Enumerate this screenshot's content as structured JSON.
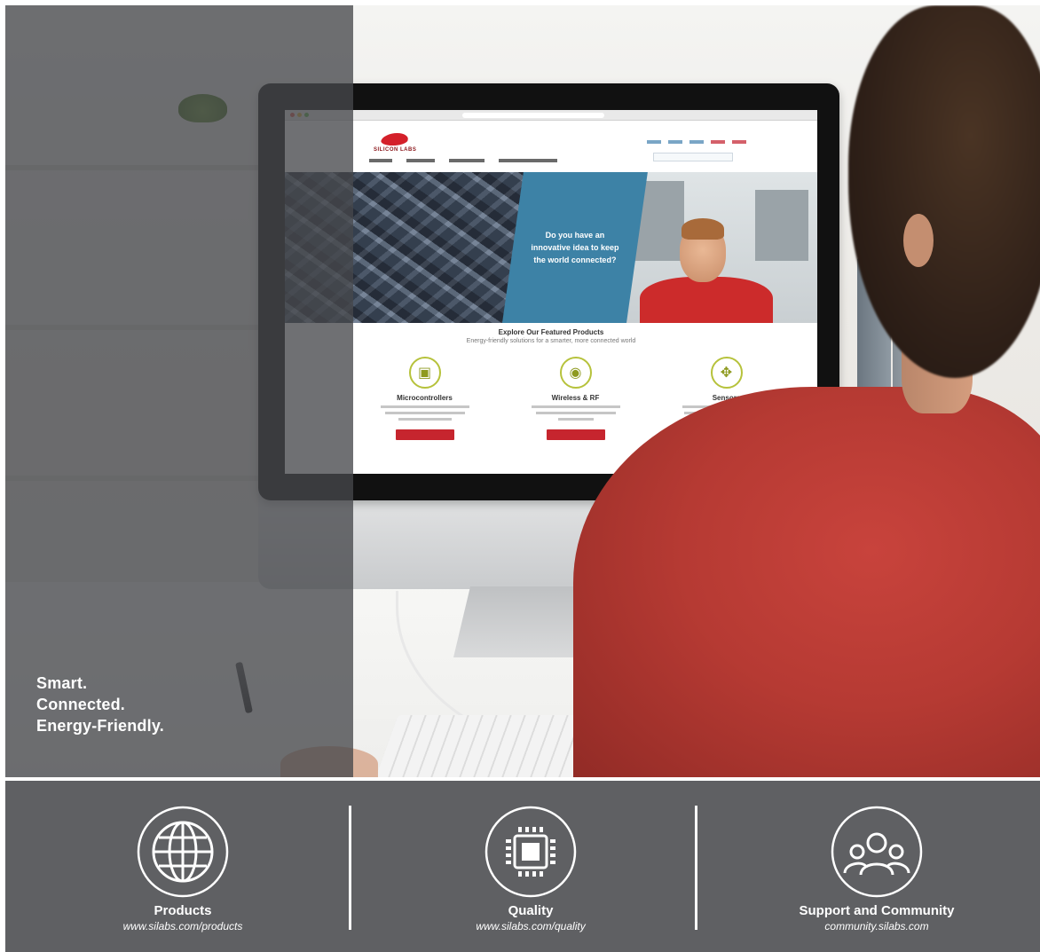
{
  "hero": {
    "tagline": [
      "Smart.",
      "Connected.",
      "Energy-Friendly."
    ]
  },
  "screen_site": {
    "logo_text": "SILICON LABS",
    "banner_text": "Do you have an innovative idea to keep the world connected?",
    "featured_title": "Explore Our Featured Products",
    "featured_subtitle": "Energy-friendly solutions for a smarter, more connected world",
    "cards": [
      {
        "title": "Microcontrollers",
        "icon": "chip-icon"
      },
      {
        "title": "Wireless & RF",
        "icon": "wifi-icon"
      },
      {
        "title": "Sensors",
        "icon": "sensor-icon"
      }
    ]
  },
  "footer": {
    "items": [
      {
        "title": "Products",
        "url": "www.silabs.com/products",
        "icon": "globe-icon"
      },
      {
        "title": "Quality",
        "url": "www.silabs.com/quality",
        "icon": "chip-icon"
      },
      {
        "title": "Support and Community",
        "url": "community.silabs.com",
        "icon": "people-icon"
      }
    ]
  },
  "colors": {
    "overlay": "#46484c",
    "footer_bg": "#5f6063",
    "brand_red": "#d4202a",
    "banner_blue": "#3d82a6"
  }
}
